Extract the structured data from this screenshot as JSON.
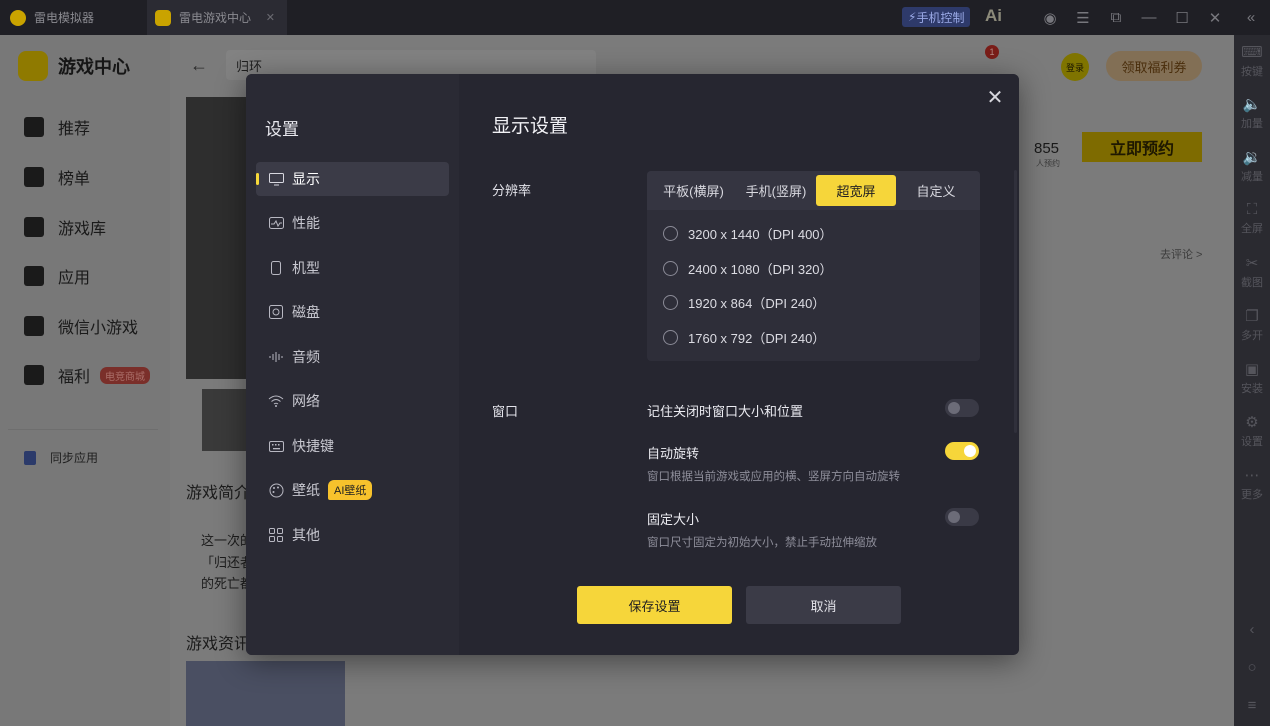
{
  "titlebar": {
    "tab1_label": "雷电模拟器",
    "tab2_label": "雷电游戏中心",
    "phone_control": "手机控制",
    "ai_label": "Ai"
  },
  "app": {
    "brand": "游戏中心",
    "search_value": "归环",
    "nav": [
      {
        "label": "推荐"
      },
      {
        "label": "榜单"
      },
      {
        "label": "游戏库"
      },
      {
        "label": "应用"
      },
      {
        "label": "微信小游戏"
      },
      {
        "label": "福利",
        "badge": "电竞商城"
      }
    ],
    "sync_label": "同步应用",
    "download_count": "1",
    "login": "登录",
    "coupon": "领取福利券",
    "reserve_count": "855",
    "reserve_count_sub": "人预约",
    "reserve_button": "立即预约",
    "go_comment": "去评论 >",
    "intro_heading": "游戏简介",
    "intro_line1": "这一次的",
    "intro_line2": "「归还者",
    "intro_line3": "的死亡都",
    "news_heading": "游戏资讯"
  },
  "rdock": {
    "items": [
      "按键",
      "加量",
      "减量",
      "全屏",
      "截图",
      "多开",
      "安装",
      "设置",
      "更多"
    ]
  },
  "modal": {
    "sidebar_title": "设置",
    "nav": [
      {
        "label": "显示",
        "icon": "monitor-icon"
      },
      {
        "label": "性能",
        "icon": "performance-icon"
      },
      {
        "label": "机型",
        "icon": "phone-icon"
      },
      {
        "label": "磁盘",
        "icon": "disk-icon"
      },
      {
        "label": "音频",
        "icon": "audio-icon"
      },
      {
        "label": "网络",
        "icon": "wifi-icon"
      },
      {
        "label": "快捷键",
        "icon": "keyboard-icon"
      },
      {
        "label": "壁纸",
        "icon": "palette-icon",
        "badge": "AI壁纸"
      },
      {
        "label": "其他",
        "icon": "grid-icon"
      }
    ],
    "title": "显示设置",
    "resolution_label": "分辨率",
    "resolution_tabs": [
      "平板(横屏)",
      "手机(竖屏)",
      "超宽屏",
      "自定义"
    ],
    "resolution_active_tab": "超宽屏",
    "resolution_options": [
      "3200 x 1440（DPI 400）",
      "2400 x 1080（DPI 320）",
      "1920 x 864（DPI 240）",
      "1760 x 792（DPI 240）"
    ],
    "window_label": "窗口",
    "window_settings": [
      {
        "title": "记住关闭时窗口大小和位置",
        "desc": "",
        "on": false
      },
      {
        "title": "自动旋转",
        "desc": "窗口根据当前游戏或应用的横、竖屏方向自动旋转",
        "on": true
      },
      {
        "title": "固定大小",
        "desc": "窗口尺寸固定为初始大小，禁止手动拉伸缩放",
        "on": false
      }
    ],
    "save_button": "保存设置",
    "cancel_button": "取消",
    "colors": {
      "accent": "#f6d63a",
      "panel": "#262630",
      "sidebar": "#2a2a34"
    }
  }
}
